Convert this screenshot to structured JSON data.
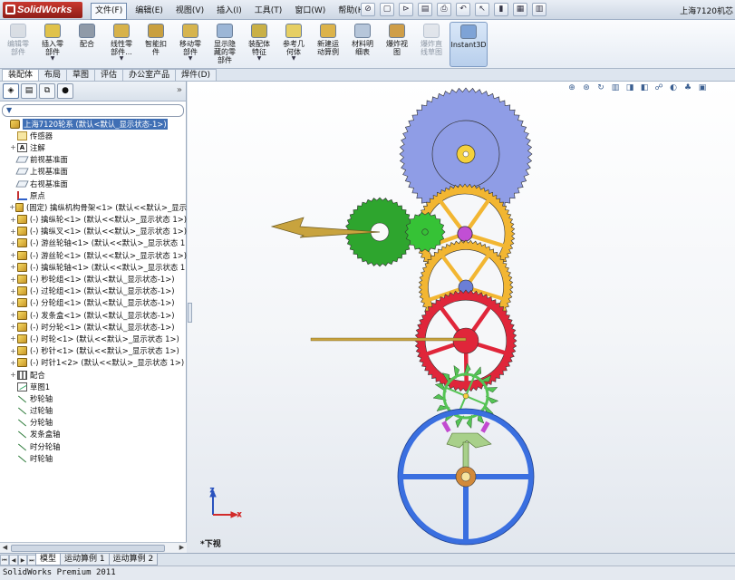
{
  "app": {
    "logo_text": "SolidWorks",
    "window_title": "上海7120机芯"
  },
  "menu": [
    "文件(F)",
    "编辑(E)",
    "视图(V)",
    "插入(I)",
    "工具(T)",
    "窗口(W)",
    "帮助(H)"
  ],
  "quick_access": [
    {
      "icon": "help-pin-icon",
      "glyph": "⊘"
    },
    {
      "icon": "new-document-icon",
      "glyph": "▢"
    },
    {
      "icon": "open-folder-icon",
      "glyph": "⊳"
    },
    {
      "icon": "save-icon",
      "glyph": "▤"
    },
    {
      "icon": "print-icon",
      "glyph": "⎙"
    },
    {
      "icon": "undo-icon",
      "glyph": "↶"
    },
    {
      "icon": "select-cursor-icon",
      "glyph": "↖"
    },
    {
      "icon": "rebuild-traffic-light-icon",
      "glyph": "▮"
    },
    {
      "icon": "file-properties-icon",
      "glyph": "▦"
    },
    {
      "icon": "options-icon",
      "glyph": "▥"
    }
  ],
  "ribbon": [
    {
      "label": "编辑零\n部件",
      "icon": "edit-component-icon",
      "color": "#b7bfc9",
      "disabled": true
    },
    {
      "label": "插入零\n部件",
      "icon": "insert-component-icon",
      "color": "#e0c24a",
      "dropdown": true
    },
    {
      "label": "配合",
      "icon": "mate-icon",
      "color": "#8f9aa8"
    },
    {
      "label": "线性零\n部件...",
      "icon": "linear-pattern-icon",
      "color": "#d7b24a",
      "dropdown": true
    },
    {
      "label": "智能扣\n件",
      "icon": "smart-fasteners-icon",
      "color": "#c9a040"
    },
    {
      "label": "移动零\n部件",
      "icon": "move-component-icon",
      "color": "#d6b44e",
      "dropdown": true
    },
    {
      "label": "显示隐\n藏的零\n部件",
      "icon": "show-hidden-icon",
      "color": "#9cb6d6"
    },
    {
      "label": "装配体\n特征",
      "icon": "assembly-features-icon",
      "color": "#c9b046",
      "dropdown": true
    },
    {
      "label": "参考几\n何体",
      "icon": "reference-geometry-icon",
      "color": "#e6cf63",
      "dropdown": true
    },
    {
      "label": "新建运\n动算例",
      "icon": "new-motion-study-icon",
      "color": "#dcb34a"
    },
    {
      "label": "材料明\n细表",
      "icon": "bom-icon",
      "color": "#b6c6da"
    },
    {
      "label": "爆炸视\n图",
      "icon": "exploded-view-icon",
      "color": "#cf9e48"
    },
    {
      "label": "爆炸直\n线草图",
      "icon": "explode-line-sketch-icon",
      "color": "#c8cfd8",
      "disabled": true
    },
    {
      "label": "Instant3D",
      "icon": "instant3d-icon",
      "color": "#7ea3d6",
      "active": true
    }
  ],
  "command_tabs": [
    "装配体",
    "布局",
    "草图",
    "评估",
    "办公室产品",
    "焊件(D)"
  ],
  "panel_tabs": [
    {
      "icon": "featuremanager-tree-icon",
      "glyph": "◈"
    },
    {
      "icon": "propertymanager-icon",
      "glyph": "▤"
    },
    {
      "icon": "configurationmanager-icon",
      "glyph": "⧉"
    },
    {
      "icon": "display-manager-icon",
      "glyph": "●"
    }
  ],
  "filter_label": "▼",
  "tree": [
    {
      "text": "上海7120轮系  (默认<默认_显示状态-1>)",
      "icon": "ic-asm",
      "toggle": "",
      "sel": true,
      "indent": 0
    },
    {
      "text": "传感器",
      "icon": "ic-sensor",
      "toggle": "",
      "indent": 1
    },
    {
      "text": "注解",
      "icon": "ic-ann",
      "toggle": "+",
      "indent": 1,
      "glyph": "A"
    },
    {
      "text": "前视基准面",
      "icon": "ic-plane",
      "toggle": "",
      "indent": 1
    },
    {
      "text": "上视基准面",
      "icon": "ic-plane",
      "toggle": "",
      "indent": 1
    },
    {
      "text": "右视基准面",
      "icon": "ic-plane",
      "toggle": "",
      "indent": 1
    },
    {
      "text": "原点",
      "icon": "ic-origin",
      "toggle": "",
      "indent": 1
    },
    {
      "text": "(固定) 擒纵机构骨架<1> (默认<<默认>_显示",
      "icon": "ic-part",
      "toggle": "+",
      "indent": 1
    },
    {
      "text": "(-) 擒纵轮<1> (默认<<默认>_显示状态 1>)",
      "icon": "ic-part",
      "toggle": "+",
      "indent": 1
    },
    {
      "text": "(-) 擒纵叉<1> (默认<<默认>_显示状态 1>)",
      "icon": "ic-part",
      "toggle": "+",
      "indent": 1
    },
    {
      "text": "(-) 游丝轮轴<1> (默认<<默认>_显示状态 1",
      "icon": "ic-part",
      "toggle": "+",
      "indent": 1
    },
    {
      "text": "(-) 游丝轮<1> (默认<<默认>_显示状态 1>)",
      "icon": "ic-part",
      "toggle": "+",
      "indent": 1
    },
    {
      "text": "(-) 擒纵轮轴<1> (默认<<默认>_显示状态 1",
      "icon": "ic-part",
      "toggle": "+",
      "indent": 1
    },
    {
      "text": "(-) 秒轮组<1> (默认<默认_显示状态-1>)",
      "icon": "ic-part",
      "toggle": "+",
      "indent": 1
    },
    {
      "text": "(-) 过轮组<1> (默认<默认_显示状态-1>)",
      "icon": "ic-part",
      "toggle": "+",
      "indent": 1
    },
    {
      "text": "(-) 分轮组<1> (默认<默认_显示状态-1>)",
      "icon": "ic-part",
      "toggle": "+",
      "indent": 1
    },
    {
      "text": "(-) 发条盒<1> (默认<默认_显示状态-1>)",
      "icon": "ic-part",
      "toggle": "+",
      "indent": 1
    },
    {
      "text": "(-) 时分轮<1> (默认<默认_显示状态-1>)",
      "icon": "ic-part",
      "toggle": "+",
      "indent": 1
    },
    {
      "text": "(-) 时轮<1> (默认<<默认>_显示状态 1>)",
      "icon": "ic-part",
      "toggle": "+",
      "indent": 1
    },
    {
      "text": "(-) 秒针<1> (默认<<默认>_显示状态 1>)",
      "icon": "ic-part",
      "toggle": "+",
      "indent": 1
    },
    {
      "text": "(-) 时针1<2> (默认<<默认>_显示状态 1>)",
      "icon": "ic-part",
      "toggle": "+",
      "indent": 1
    },
    {
      "text": "配合",
      "icon": "ic-mate",
      "toggle": "+",
      "indent": 1
    },
    {
      "text": "草图1",
      "icon": "ic-sketch",
      "toggle": "",
      "indent": 1
    },
    {
      "text": "秒轮轴",
      "icon": "ic-axis",
      "toggle": "",
      "indent": 1
    },
    {
      "text": "过轮轴",
      "icon": "ic-axis",
      "toggle": "",
      "indent": 1
    },
    {
      "text": "分轮轴",
      "icon": "ic-axis",
      "toggle": "",
      "indent": 1
    },
    {
      "text": "发条盒轴",
      "icon": "ic-axis",
      "toggle": "",
      "indent": 1
    },
    {
      "text": "时分轮轴",
      "icon": "ic-axis",
      "toggle": "",
      "indent": 1
    },
    {
      "text": "时轮轴",
      "icon": "ic-axis",
      "toggle": "",
      "indent": 1
    }
  ],
  "hud": [
    {
      "icon": "zoom-to-fit-icon",
      "glyph": "⊕"
    },
    {
      "icon": "zoom-area-icon",
      "glyph": "⊛"
    },
    {
      "icon": "previous-view-icon",
      "glyph": "↻"
    },
    {
      "icon": "section-view-icon",
      "glyph": "▥"
    },
    {
      "icon": "view-orientation-icon",
      "glyph": "◨"
    },
    {
      "icon": "display-style-icon",
      "glyph": "◧"
    },
    {
      "icon": "hide-show-items-icon",
      "glyph": "☍"
    },
    {
      "icon": "edit-appearance-icon",
      "glyph": "◐"
    },
    {
      "icon": "apply-scene-icon",
      "glyph": "♣"
    },
    {
      "icon": "view-settings-icon",
      "glyph": "▣"
    }
  ],
  "view_name": "*下视",
  "triad": {
    "x_label": "X",
    "z_label": "Z",
    "x_color": "#d22b2b",
    "z_color": "#2a52be"
  },
  "model_colors": {
    "barrel": "#8f9de6",
    "center_wheel": "#f2b632",
    "third_wheel": "#2ea52e",
    "fourth_wheel": "#e0263a",
    "escape_wheel": "#55c455",
    "pallet_fork": "#a8d08a",
    "balance_wheel": "#3a6fe0",
    "hands": "#c8a33e"
  },
  "bottom_tabs": [
    "模型",
    "运动算例 1",
    "运动算例 2"
  ],
  "status": "SolidWorks Premium 2011"
}
